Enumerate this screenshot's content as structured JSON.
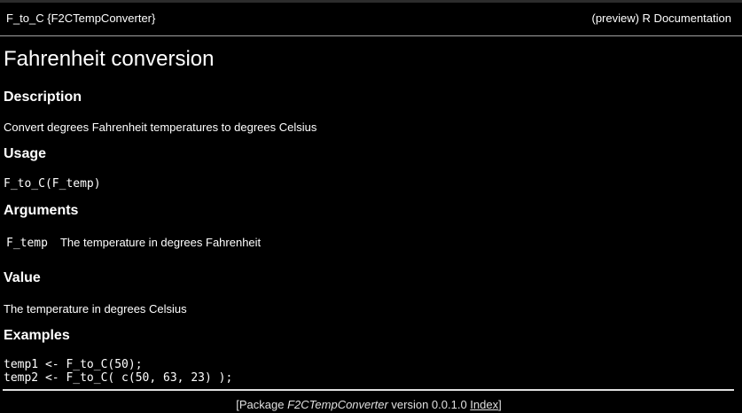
{
  "header": {
    "topic": "F_to_C {F2CTempConverter}",
    "right_label": "(preview) R Documentation"
  },
  "doc": {
    "title": "Fahrenheit conversion",
    "description_heading": "Description",
    "description_text": "Convert degrees Fahrenheit temperatures to degrees Celsius",
    "usage_heading": "Usage",
    "usage_code": "F_to_C(F_temp)",
    "arguments_heading": "Arguments",
    "arguments": [
      {
        "name": "F_temp",
        "description": "The temperature in degrees Fahrenheit"
      }
    ],
    "value_heading": "Value",
    "value_text": "The temperature in degrees Celsius",
    "examples_heading": "Examples",
    "examples_lines": [
      "temp1 <- F_to_C(50);",
      "temp2 <- F_to_C( c(50, 63, 23) );"
    ]
  },
  "footer": {
    "prefix": "[Package ",
    "package_name": "F2CTempConverter",
    "version_text": " version 0.0.1.0 ",
    "index_link": "Index",
    "suffix": "]"
  }
}
